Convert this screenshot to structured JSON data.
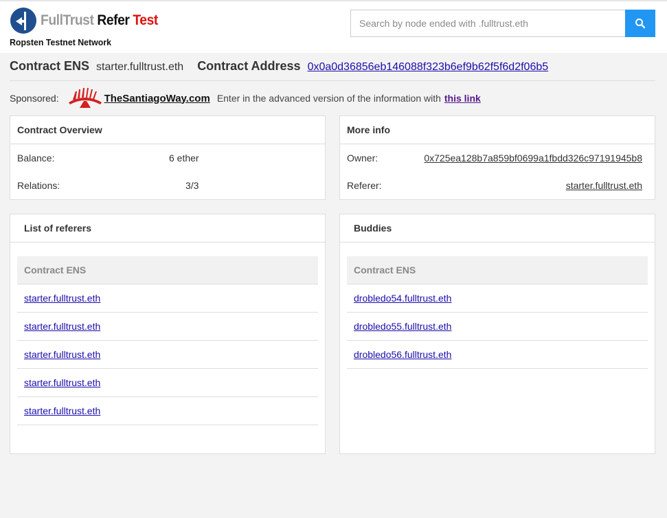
{
  "header": {
    "brand_word1": "FullTrust",
    "brand_word2": "Refer",
    "brand_word3": "Test",
    "network": "Ropsten Testnet Network",
    "search_placeholder": "Search by node ended with .fulltrust.eth"
  },
  "contract": {
    "ens_label": "Contract ENS",
    "ens_value": "starter.fulltrust.eth",
    "address_label": "Contract Address",
    "address_value": "0x0a0d36856eb146088f323b6ef9b62f5f6d2f06b5"
  },
  "sponsored": {
    "label": "Sponsored:",
    "sponsor_name": "TheSantiagoWay.com",
    "text": "Enter in the advanced version of the information with",
    "link_text": "this link"
  },
  "overview": {
    "title": "Contract Overview",
    "balance_label": "Balance:",
    "balance_value": "6 ether",
    "relations_label": "Relations:",
    "relations_value": "3/3"
  },
  "more_info": {
    "title": "More info",
    "owner_label": "Owner:",
    "owner_value": "0x725ea128b7a859bf0699a1fbdd326c97191945b8",
    "referer_label": "Referer:",
    "referer_value": "starter.fulltrust.eth"
  },
  "referers": {
    "title": "List of referers",
    "column": "Contract ENS",
    "rows": [
      "starter.fulltrust.eth",
      "starter.fulltrust.eth",
      "starter.fulltrust.eth",
      "starter.fulltrust.eth",
      "starter.fulltrust.eth"
    ]
  },
  "buddies": {
    "title": "Buddies",
    "column": "Contract ENS",
    "rows": [
      "drobledo54.fulltrust.eth",
      "drobledo55.fulltrust.eth",
      "drobledo56.fulltrust.eth"
    ]
  },
  "colors": {
    "accent": "#2196f3",
    "brand_red": "#e01010",
    "brand_grey": "#9a9a9a",
    "link": "#1a0dab",
    "visited_link": "#551a8b"
  },
  "icons": {
    "logo": "signpost-icon",
    "search": "search-icon",
    "sponsor": "sponsor-logo-icon"
  }
}
